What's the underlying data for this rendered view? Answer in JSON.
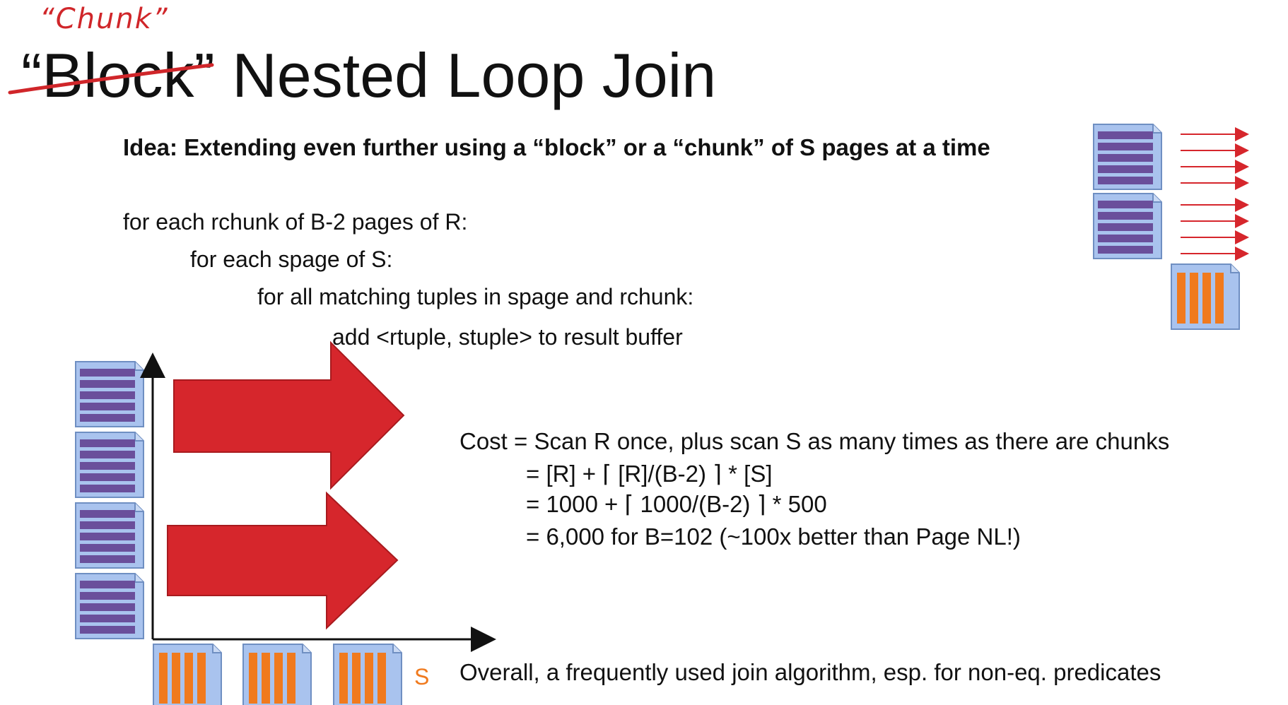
{
  "title": {
    "annotation": "“Chunk”",
    "struck_word": "“Block”",
    "rest": "Nested Loop Join"
  },
  "idea": "Idea: Extending even further using a “block” or a “chunk” of S pages at a time",
  "pseudocode": [
    "for each rchunk of B-2 pages of R:",
    "for each spage of S:",
    "for all matching tuples in spage and rchunk:",
    "add <rtuple, stuple> to result buffer"
  ],
  "cost": [
    "Cost = Scan R once, plus scan S as many times as there are chunks",
    "= [R] + ⌈  [R]/(B-2) ⌉ * [S]",
    "= 1000 + ⌈ 1000/(B-2) ⌉ * 500",
    "= 6,000 for B=102 (~100x better than Page NL!)"
  ],
  "s_axis_label": "S",
  "overall": "Overall, a frequently used join algorithm, esp. for non-eq. predicates",
  "colors": {
    "annotation_red": "#d0262a",
    "arrow_red": "#d6262c",
    "r_page_purple": "#6a4f9b",
    "r_page_bg": "#a9c3ee",
    "s_page_orange": "#f07a1e",
    "text": "#111111"
  }
}
